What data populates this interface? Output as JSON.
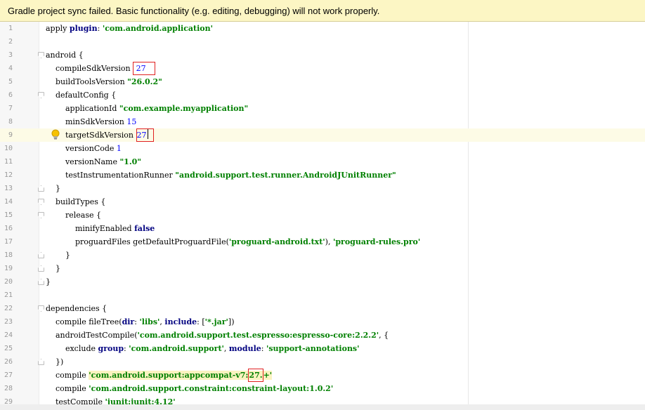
{
  "banner": {
    "message": "Gradle project sync failed. Basic functionality (e.g. editing, debugging) will not work properly."
  },
  "editor": {
    "file_type": "Gradle build script",
    "current_line": 9,
    "lines": [
      {
        "n": "1",
        "code": "apply plugin: 'com.android.application'"
      },
      {
        "n": "2",
        "code": ""
      },
      {
        "n": "3",
        "code": "android {"
      },
      {
        "n": "4",
        "code": "    compileSdkVersion 27"
      },
      {
        "n": "5",
        "code": "    buildToolsVersion \"26.0.2\""
      },
      {
        "n": "6",
        "code": "    defaultConfig {"
      },
      {
        "n": "7",
        "code": "        applicationId \"com.example.myapplication\""
      },
      {
        "n": "8",
        "code": "        minSdkVersion 15"
      },
      {
        "n": "9",
        "code": "        targetSdkVersion 27"
      },
      {
        "n": "10",
        "code": "        versionCode 1"
      },
      {
        "n": "11",
        "code": "        versionName \"1.0\""
      },
      {
        "n": "12",
        "code": "        testInstrumentationRunner \"android.support.test.runner.AndroidJUnitRunner\""
      },
      {
        "n": "13",
        "code": "    }"
      },
      {
        "n": "14",
        "code": "    buildTypes {"
      },
      {
        "n": "15",
        "code": "        release {"
      },
      {
        "n": "16",
        "code": "            minifyEnabled false"
      },
      {
        "n": "17",
        "code": "            proguardFiles getDefaultProguardFile('proguard-android.txt'), 'proguard-rules.pro'"
      },
      {
        "n": "18",
        "code": "        }"
      },
      {
        "n": "19",
        "code": "    }"
      },
      {
        "n": "20",
        "code": "}"
      },
      {
        "n": "21",
        "code": ""
      },
      {
        "n": "22",
        "code": "dependencies {"
      },
      {
        "n": "23",
        "code": "    compile fileTree(dir: 'libs', include: ['*.jar'])"
      },
      {
        "n": "24",
        "code": "    androidTestCompile('com.android.support.test.espresso:espresso-core:2.2.2', {"
      },
      {
        "n": "25",
        "code": "        exclude group: 'com.android.support', module: 'support-annotations'"
      },
      {
        "n": "26",
        "code": "    })"
      },
      {
        "n": "27",
        "code": "    compile 'com.android.support:appcompat-v7:27.+'"
      },
      {
        "n": "28",
        "code": "    compile 'com.android.support.constraint:constraint-layout:1.0.2'"
      },
      {
        "n": "29",
        "code": "    testCompile 'junit:junit:4.12'"
      }
    ],
    "highlighted_values": [
      "27",
      "27",
      "27."
    ],
    "annotation_color": "#e02020",
    "intention_icon": "lightbulb-icon"
  }
}
